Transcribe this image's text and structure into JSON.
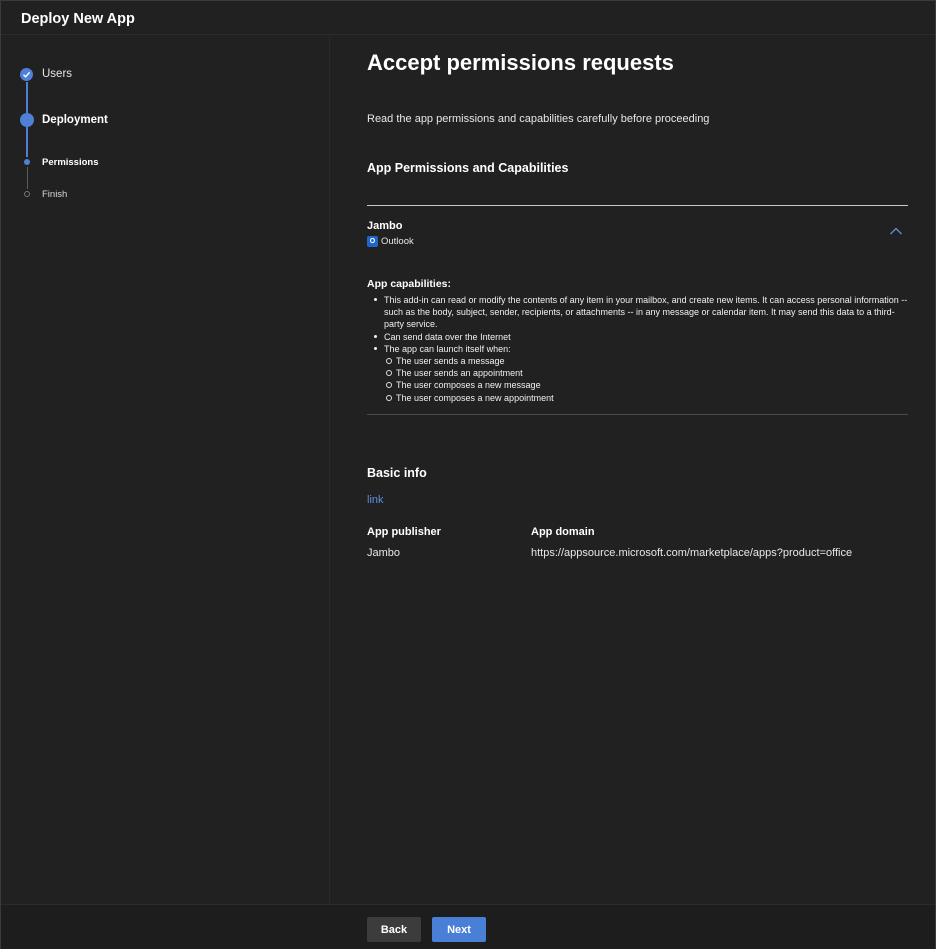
{
  "header": {
    "title": "Deploy New App"
  },
  "steps": [
    {
      "label": "Users",
      "state": "done"
    },
    {
      "label": "Deployment",
      "state": "current"
    },
    {
      "label": "Permissions",
      "state": "current-sub"
    },
    {
      "label": "Finish",
      "state": "todo"
    }
  ],
  "main": {
    "title": "Accept permissions requests",
    "subtitle": "Read the app permissions and capabilities carefully before proceeding",
    "section_title": "App Permissions and Capabilities",
    "app": {
      "name": "Jambo",
      "host": "Outlook",
      "host_icon_letter": "O",
      "capabilities_title": "App capabilities:",
      "capabilities": [
        "This add-in can read or modify the contents of any item in your mailbox, and create new items. It can access personal information -- such as the body, subject, sender, recipients, or attachments -- in any message or calendar item. It may send this data to a third-party service.",
        "Can send data over the Internet",
        "The app can launch itself when:"
      ],
      "launch_conditions": [
        "The user sends a message",
        "The user sends an appointment",
        "The user composes a new message",
        "The user composes a new appointment"
      ]
    },
    "basic_info": {
      "title": "Basic info",
      "link_label": "link",
      "publisher_label": "App publisher",
      "publisher_value": "Jambo",
      "domain_label": "App domain",
      "domain_value": "https://appsource.microsoft.com/marketplace/apps?product=office"
    }
  },
  "footer": {
    "back_label": "Back",
    "next_label": "Next"
  },
  "colors": {
    "accent": "#4a7fd8",
    "background": "#212121"
  }
}
